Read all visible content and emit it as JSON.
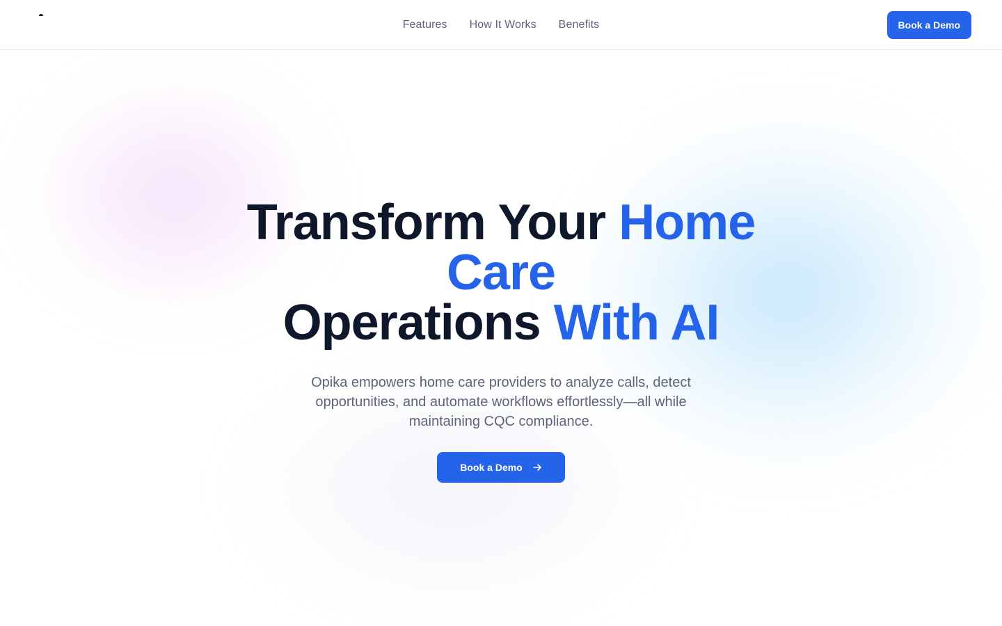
{
  "colors": {
    "accent": "#2563eb",
    "heading": "#0f172a",
    "muted": "#5b6478",
    "divider": "#e5e7eb"
  },
  "header": {
    "nav": [
      {
        "label": "Features"
      },
      {
        "label": "How It Works"
      },
      {
        "label": "Benefits"
      }
    ],
    "cta_label": "Book a Demo"
  },
  "hero": {
    "title_line1_dark": "Transform Your ",
    "title_line1_accent": "Home",
    "title_line2_accent": "Care",
    "title_line3_dark": "Operations ",
    "title_line3_accent": "With AI",
    "subtitle": "Opika empowers home care providers to analyze calls, detect opportunities, and automate workflows effortlessly—all while maintaining CQC compliance.",
    "cta_label": "Book a Demo",
    "cta_icon": "arrow-right-icon"
  }
}
